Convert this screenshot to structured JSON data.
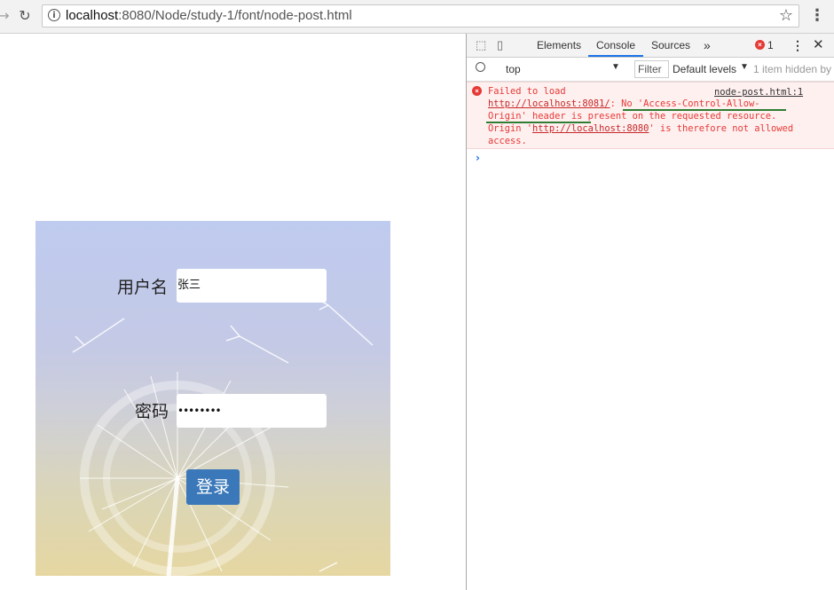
{
  "browser": {
    "url_host": "localhost",
    "url_path": ":8080/Node/study-1/font/node-post.html"
  },
  "login_form": {
    "username_label": "用户名",
    "username_value": "张三",
    "password_label": "密码",
    "password_value": "••••••••",
    "submit_label": "登录"
  },
  "devtools": {
    "tabs": [
      "Elements",
      "Console",
      "Sources"
    ],
    "active_tab": "Console",
    "more_tabs": "»",
    "error_count": "1",
    "context": "top",
    "filter_placeholder": "Filter",
    "levels": "Default levels",
    "hidden_note": "1 item hidden by",
    "error": {
      "line1": "Failed to load",
      "source": "node-post.html:1",
      "url": "http://localhost:8081/",
      "line2_rest": ": No 'Access-Control-Allow-",
      "line3_a": "Origin' header is",
      "line3_b": " present on the requested resource.",
      "line4_a": "Origin '",
      "origin": "http://localhost:8080",
      "line4_b": "' is therefore not allowed",
      "line5": "access."
    },
    "prompt": "›"
  }
}
